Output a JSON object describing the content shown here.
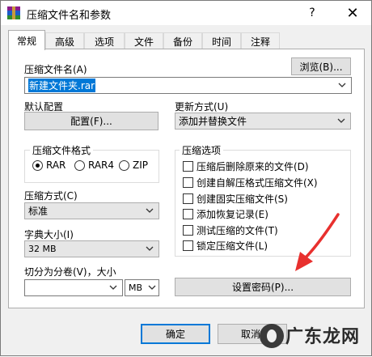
{
  "window": {
    "title": "压缩文件名和参数",
    "help_label": "?",
    "close_label": "✕"
  },
  "tabs": [
    {
      "label": "常规",
      "active": true
    },
    {
      "label": "高级",
      "active": false
    },
    {
      "label": "选项",
      "active": false
    },
    {
      "label": "文件",
      "active": false
    },
    {
      "label": "备份",
      "active": false
    },
    {
      "label": "时间",
      "active": false
    },
    {
      "label": "注释",
      "active": false
    }
  ],
  "archive_name": {
    "label": "压缩文件名(A)",
    "value": "新建文件夹.rar",
    "browse_label": "浏览(B)..."
  },
  "profile": {
    "label": "默认配置",
    "button_label": "配置(F)..."
  },
  "update_mode": {
    "label": "更新方式(U)",
    "value": "添加并替换文件"
  },
  "format": {
    "legend": "压缩文件格式",
    "options": [
      {
        "label": "RAR",
        "checked": true
      },
      {
        "label": "RAR4",
        "checked": false
      },
      {
        "label": "ZIP",
        "checked": false
      }
    ]
  },
  "method": {
    "label": "压缩方式(C)",
    "value": "标准"
  },
  "dictionary": {
    "label": "字典大小(I)",
    "value": "32 MB"
  },
  "split": {
    "label": "切分为分卷(V)，大小",
    "value": "",
    "unit": "MB"
  },
  "options": {
    "legend": "压缩选项",
    "items": [
      {
        "label": "压缩后删除原来的文件(D)",
        "checked": false
      },
      {
        "label": "创建自解压格式压缩文件(X)",
        "checked": false
      },
      {
        "label": "创建固实压缩文件(S)",
        "checked": false
      },
      {
        "label": "添加恢复记录(E)",
        "checked": false
      },
      {
        "label": "测试压缩的文件(T)",
        "checked": false
      },
      {
        "label": "锁定压缩文件(L)",
        "checked": false
      }
    ]
  },
  "password_button": "设置密码(P)...",
  "footer": {
    "ok_label": "确定",
    "cancel_label": "取消"
  },
  "watermark_text": "广东龙网",
  "colors": {
    "accent": "#0078d7",
    "arrow": "#e8302e"
  },
  "icons": [
    "winrar-app-icon",
    "chevron-down-icon",
    "red-arrow-annotation",
    "watermark-logo-icon"
  ]
}
